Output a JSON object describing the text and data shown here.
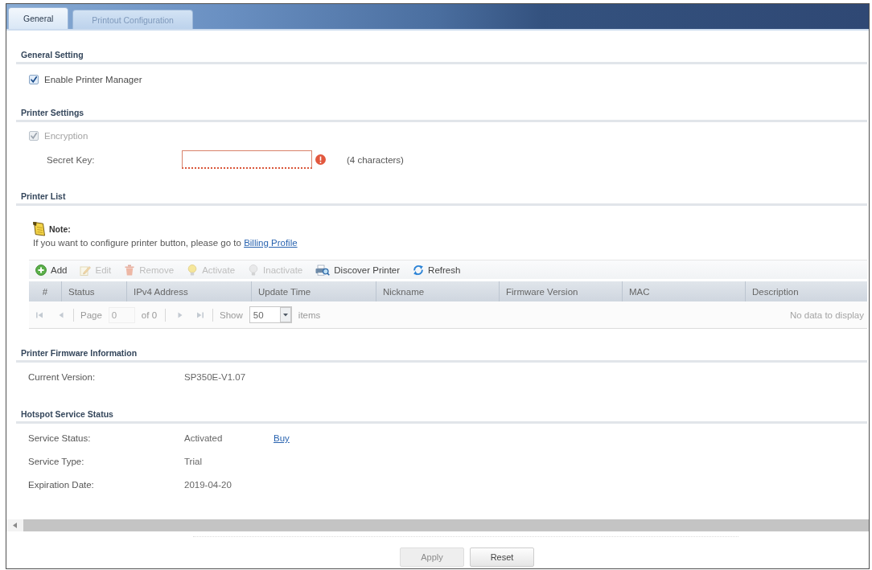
{
  "tabs": [
    {
      "label": "General",
      "selected": true
    },
    {
      "label": "Printout Configuration",
      "selected": false
    }
  ],
  "general_setting": {
    "title": "General Setting",
    "enable_printer_manager": {
      "label": "Enable Printer Manager",
      "checked": true
    }
  },
  "printer_settings": {
    "title": "Printer Settings",
    "encryption": {
      "label": "Encryption",
      "checked": true,
      "disabled": true
    },
    "secret_key": {
      "label": "Secret Key:",
      "invalid": true,
      "hint": "(4 characters)"
    }
  },
  "printer_list": {
    "title": "Printer List",
    "note": {
      "title": "Note:",
      "text": "If you want to configure printer button, please go to",
      "link": "Billing Profile"
    },
    "toolbar": [
      {
        "kind": "add",
        "label": "Add",
        "disabled": false
      },
      {
        "kind": "edit",
        "label": "Edit",
        "disabled": true
      },
      {
        "kind": "remove",
        "label": "Remove",
        "disabled": true
      },
      {
        "kind": "activate",
        "label": "Activate",
        "disabled": true
      },
      {
        "kind": "inactivate",
        "label": "Inactivate",
        "disabled": true
      },
      {
        "kind": "discover",
        "label": "Discover Printer",
        "disabled": false
      },
      {
        "kind": "refresh",
        "label": "Refresh",
        "disabled": false
      }
    ],
    "table": {
      "columns": [
        "#",
        "Status",
        "IPv4 Address",
        "Update Time",
        "Nickname",
        "Firmware Version",
        "MAC",
        "Description"
      ],
      "empty_message": "No data to display"
    },
    "pager": {
      "nav_disabled": true,
      "page_label": "Page",
      "page": "0",
      "page_count": "of 0",
      "show_label": "Show",
      "page_size": "50",
      "items_label": "items"
    }
  },
  "printer_firmware_information": {
    "title": "Printer Firmware Information",
    "rows": [
      {
        "label": "Current Version:",
        "value": "SP350E-V1.07"
      }
    ]
  },
  "hotspot_service_status": {
    "title": "Hotspot Service Status",
    "rows": [
      {
        "label": "Service Status:",
        "value": "Activated",
        "link": "Buy"
      },
      {
        "label": "Service Type:",
        "value": "Trial"
      },
      {
        "label": "Expiration Date:",
        "value": "2019-04-20"
      }
    ]
  },
  "buttons": [
    {
      "label": "Apply",
      "disabled": true
    },
    {
      "label": "Reset",
      "disabled": false
    }
  ]
}
